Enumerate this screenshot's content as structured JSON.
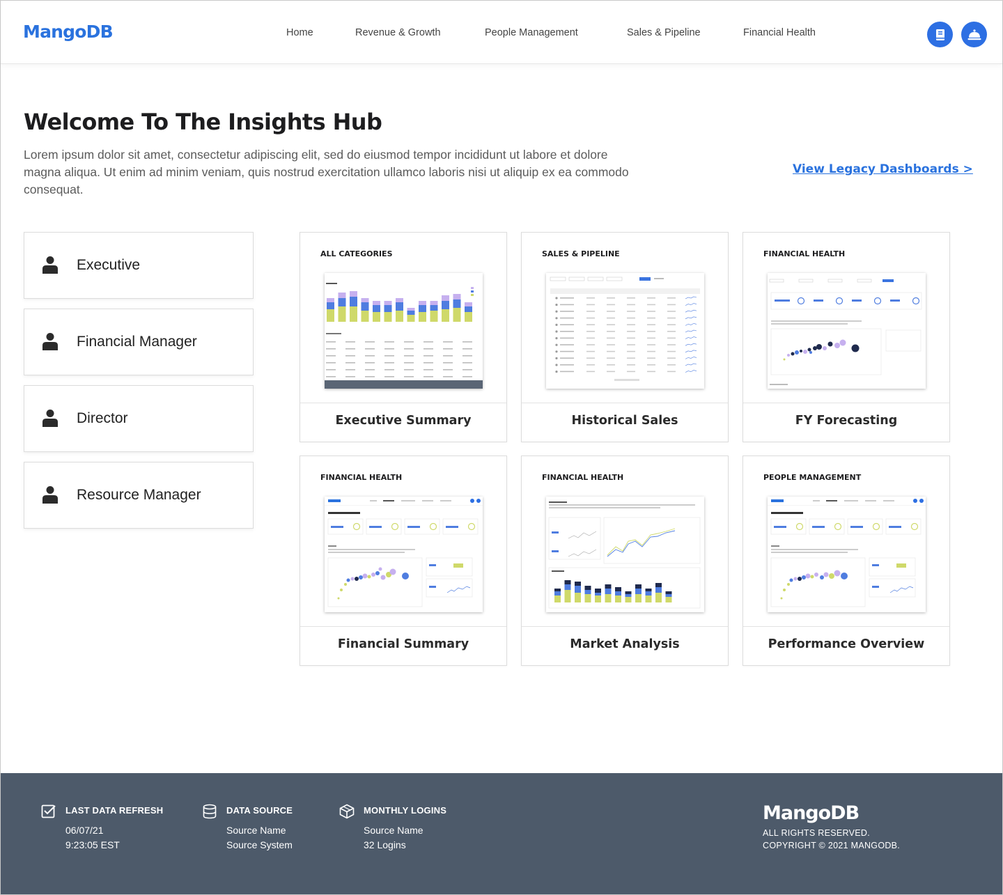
{
  "app": {
    "logo": "MangoDB"
  },
  "nav": {
    "items": [
      {
        "label": "Home"
      },
      {
        "label": "Revenue & Growth"
      },
      {
        "label": "People Management"
      },
      {
        "label": "Sales & Pipeline"
      },
      {
        "label": "Financial Health"
      }
    ],
    "icons": [
      "book-icon",
      "service-bell-icon"
    ]
  },
  "intro": {
    "title": "Welcome To The Insights Hub",
    "body": "Lorem ipsum dolor sit amet, consectetur adipiscing elit, sed do eiusmod tempor incididunt ut labore et dolore magna aliqua. Ut enim ad minim veniam, quis nostrud exercitation ullamco laboris nisi ut aliquip ex ea commodo consequat.",
    "legacy_link": "View Legacy Dashboards >"
  },
  "roles": [
    {
      "label": "Executive",
      "icon": "person-icon"
    },
    {
      "label": "Financial Manager",
      "icon": "person-icon"
    },
    {
      "label": "Director",
      "icon": "person-icon"
    },
    {
      "label": "Resource Manager",
      "icon": "person-icon"
    }
  ],
  "dashboards": [
    {
      "category": "ALL CATEGORIES",
      "title": "Executive Summary"
    },
    {
      "category": "SALES & PIPELINE",
      "title": "Historical Sales"
    },
    {
      "category": "FINANCIAL HEALTH",
      "title": "FY Forecasting"
    },
    {
      "category": "FINANCIAL HEALTH",
      "title": "Financial Summary"
    },
    {
      "category": "FINANCIAL HEALTH",
      "title": "Market Analysis"
    },
    {
      "category": "PEOPLE MANAGEMENT",
      "title": "Performance Overview"
    }
  ],
  "footer": {
    "refresh": {
      "heading": "LAST DATA REFRESH",
      "date": "06/07/21",
      "time": "9:23:05 EST",
      "icon": "checkbox-icon"
    },
    "source": {
      "heading": "DATA SOURCE",
      "name": "Source Name",
      "system": "Source System",
      "icon": "database-icon"
    },
    "logins": {
      "heading": "MONTHLY LOGINS",
      "name": "Source Name",
      "count": "32 Logins",
      "icon": "cube-icon"
    },
    "logo": "MangoDB",
    "rights": "ALL RIGHTS RESERVED.",
    "copyright": "COPYRIGHT © 2021 MANGODB."
  },
  "colors": {
    "brand": "#2a72de",
    "footer_bg": "#4d5a6a",
    "chart_green": "#cfd96a",
    "chart_blue": "#4f7de0",
    "chart_purple": "#c6b0ef",
    "chart_navy": "#1f2a4d"
  }
}
